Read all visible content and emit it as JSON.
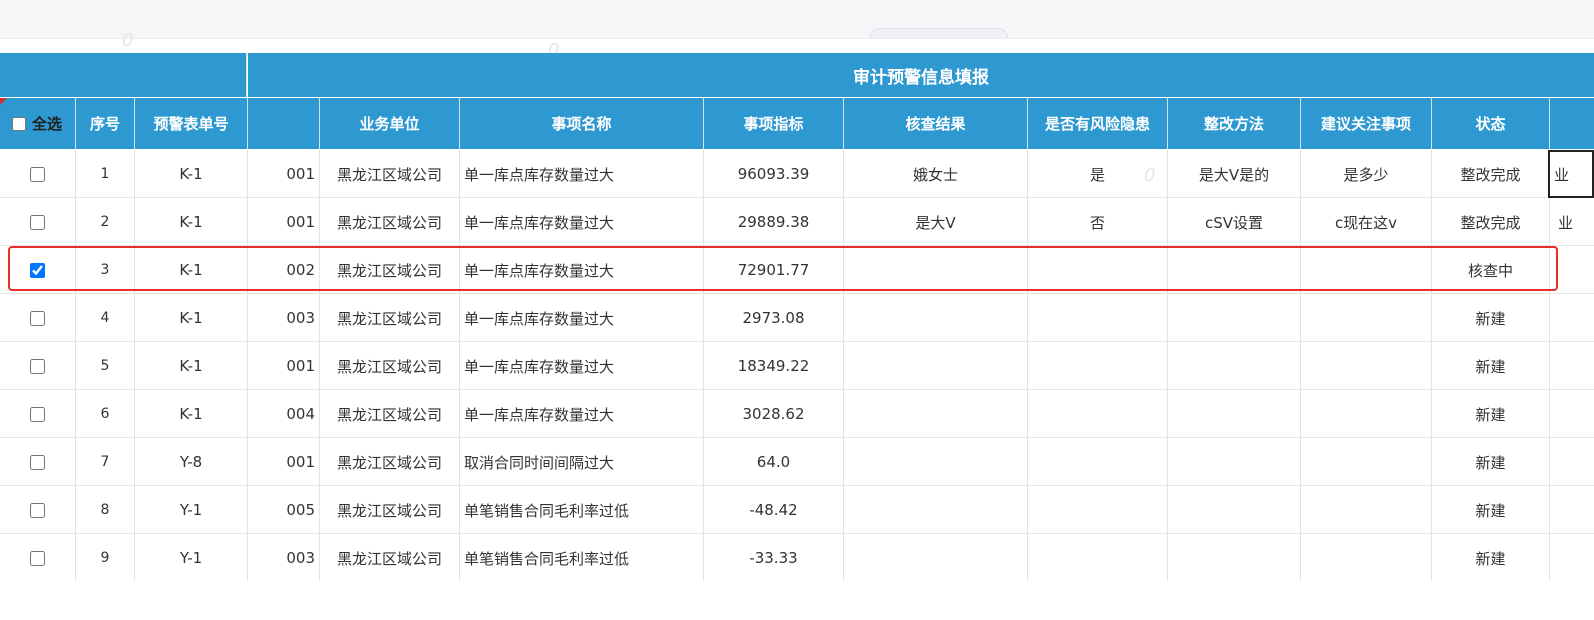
{
  "grid": {
    "group_title": "审计预警信息填报",
    "select_all_label": "全选",
    "columns": {
      "seq": "序号",
      "warn_no": "预警表单号",
      "unit": "业务单位",
      "item": "事项名称",
      "metric": "事项指标",
      "result": "核查结果",
      "risk": "是否有风险隐患",
      "method": "整改方法",
      "advice": "建议关注事项",
      "status": "状态"
    },
    "rows": [
      {
        "checked": false,
        "seq": "1",
        "warn_no": "K-1",
        "code": "001",
        "unit": "黑龙江区域公司",
        "item": "单一库点库存数量过大",
        "metric": "96093.39",
        "result": "娥女士",
        "risk": "是",
        "method": "是大V是的",
        "advice": "是多少",
        "status": "整改完成"
      },
      {
        "checked": false,
        "seq": "2",
        "warn_no": "K-1",
        "code": "001",
        "unit": "黑龙江区域公司",
        "item": "单一库点库存数量过大",
        "metric": "29889.38",
        "result": "是大V",
        "risk": "否",
        "method": "cSV设置",
        "advice": "c现在这v",
        "status": "整改完成"
      },
      {
        "checked": true,
        "seq": "3",
        "warn_no": "K-1",
        "code": "002",
        "unit": "黑龙江区域公司",
        "item": "单一库点库存数量过大",
        "metric": "72901.77",
        "result": "",
        "risk": "",
        "method": "",
        "advice": "",
        "status": "核查中"
      },
      {
        "checked": false,
        "seq": "4",
        "warn_no": "K-1",
        "code": "003",
        "unit": "黑龙江区域公司",
        "item": "单一库点库存数量过大",
        "metric": "2973.08",
        "result": "",
        "risk": "",
        "method": "",
        "advice": "",
        "status": "新建"
      },
      {
        "checked": false,
        "seq": "5",
        "warn_no": "K-1",
        "code": "001",
        "unit": "黑龙江区域公司",
        "item": "单一库点库存数量过大",
        "metric": "18349.22",
        "result": "",
        "risk": "",
        "method": "",
        "advice": "",
        "status": "新建"
      },
      {
        "checked": false,
        "seq": "6",
        "warn_no": "K-1",
        "code": "004",
        "unit": "黑龙江区域公司",
        "item": "单一库点库存数量过大",
        "metric": "3028.62",
        "result": "",
        "risk": "",
        "method": "",
        "advice": "",
        "status": "新建"
      },
      {
        "checked": false,
        "seq": "7",
        "warn_no": "Y-8",
        "code": "001",
        "unit": "黑龙江区域公司",
        "item": "取消合同时间间隔过大",
        "metric": "64.0",
        "result": "",
        "risk": "",
        "method": "",
        "advice": "",
        "status": "新建"
      },
      {
        "checked": false,
        "seq": "8",
        "warn_no": "Y-1",
        "code": "005",
        "unit": "黑龙江区域公司",
        "item": "单笔销售合同毛利率过低",
        "metric": "-48.42",
        "result": "",
        "risk": "",
        "method": "",
        "advice": "",
        "status": "新建"
      },
      {
        "checked": false,
        "seq": "9",
        "warn_no": "Y-1",
        "code": "003",
        "unit": "黑龙江区域公司",
        "item": "单笔销售合同毛利率过低",
        "metric": "-33.33",
        "result": "",
        "risk": "",
        "method": "",
        "advice": "",
        "status": "新建"
      }
    ],
    "row1_extra": "业",
    "row2_extra": "业"
  },
  "watermark": "0",
  "colors": {
    "header_bg": "#2e99d1",
    "highlight": "#e8302a"
  }
}
